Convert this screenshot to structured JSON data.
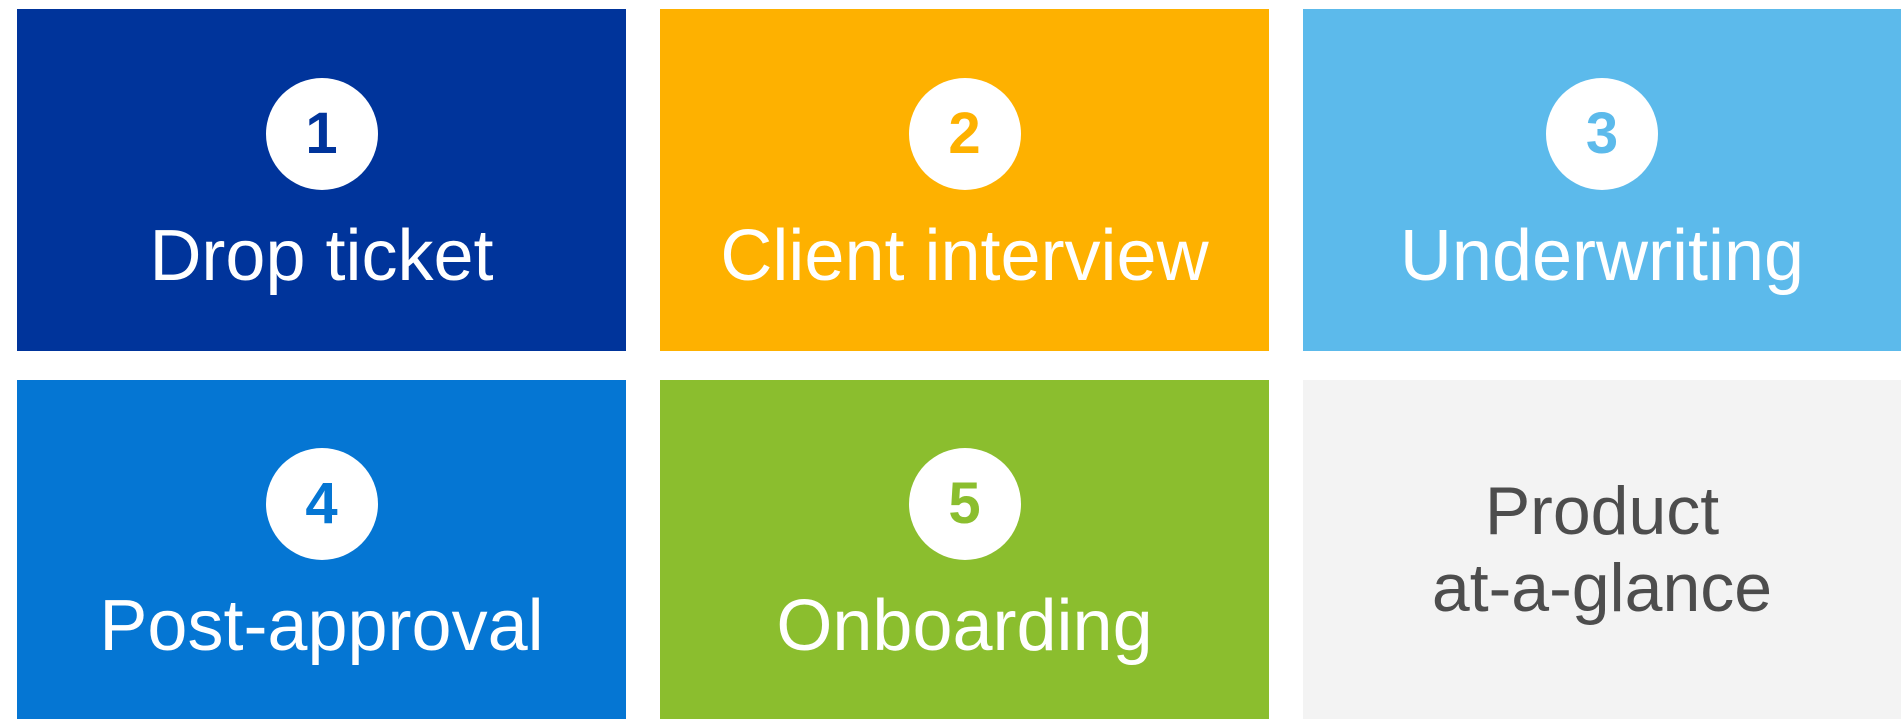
{
  "tiles": [
    {
      "number": "1",
      "label": "Drop ticket",
      "color": "#00349B"
    },
    {
      "number": "2",
      "label": "Client interview",
      "color": "#FEB100"
    },
    {
      "number": "3",
      "label": "Underwriting",
      "color": "#5CBAEB"
    },
    {
      "number": "4",
      "label": "Post-approval",
      "color": "#0576D3"
    },
    {
      "number": "5",
      "label": "Onboarding",
      "color": "#8BBE2E"
    }
  ],
  "product_tile": {
    "line1": "Product",
    "line2": "at-a-glance",
    "color": "#F3F3F3",
    "text_color": "#4D4D4D"
  }
}
